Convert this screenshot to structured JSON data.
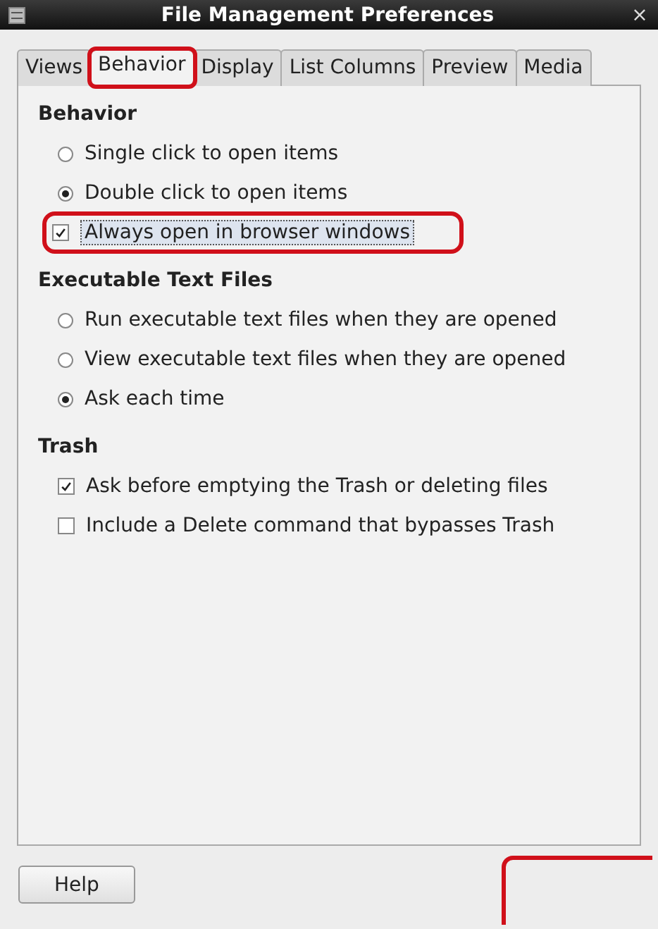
{
  "window": {
    "title": "File Management Preferences",
    "close": "×"
  },
  "tabs": [
    {
      "label": "Views",
      "selected": false,
      "highlighted": false
    },
    {
      "label": "Behavior",
      "selected": true,
      "highlighted": true
    },
    {
      "label": "Display",
      "selected": false,
      "highlighted": false
    },
    {
      "label": "List Columns",
      "selected": false,
      "highlighted": false
    },
    {
      "label": "Preview",
      "selected": false,
      "highlighted": false
    },
    {
      "label": "Media",
      "selected": false,
      "highlighted": false
    }
  ],
  "sections": [
    {
      "title": "Behavior",
      "options": [
        {
          "kind": "radio",
          "label": "Single click to open items",
          "selected": false,
          "highlighted": false
        },
        {
          "kind": "radio",
          "label": "Double click to open items",
          "selected": true,
          "highlighted": false
        },
        {
          "kind": "checkbox",
          "label": "Always open in browser windows",
          "checked": true,
          "highlighted": true
        }
      ]
    },
    {
      "title": "Executable Text Files",
      "options": [
        {
          "kind": "radio",
          "label": "Run executable text files when they are opened",
          "selected": false,
          "highlighted": false
        },
        {
          "kind": "radio",
          "label": "View executable text files when they are opened",
          "selected": false,
          "highlighted": false
        },
        {
          "kind": "radio",
          "label": "Ask each time",
          "selected": true,
          "highlighted": false
        }
      ]
    },
    {
      "title": "Trash",
      "options": [
        {
          "kind": "checkbox",
          "label": "Ask before emptying the Trash or deleting files",
          "checked": true,
          "highlighted": false
        },
        {
          "kind": "checkbox",
          "label": "Include a Delete command that bypasses Trash",
          "checked": false,
          "highlighted": false
        }
      ]
    }
  ],
  "buttons": [
    {
      "label": "Help"
    }
  ],
  "corner_highlight": true
}
